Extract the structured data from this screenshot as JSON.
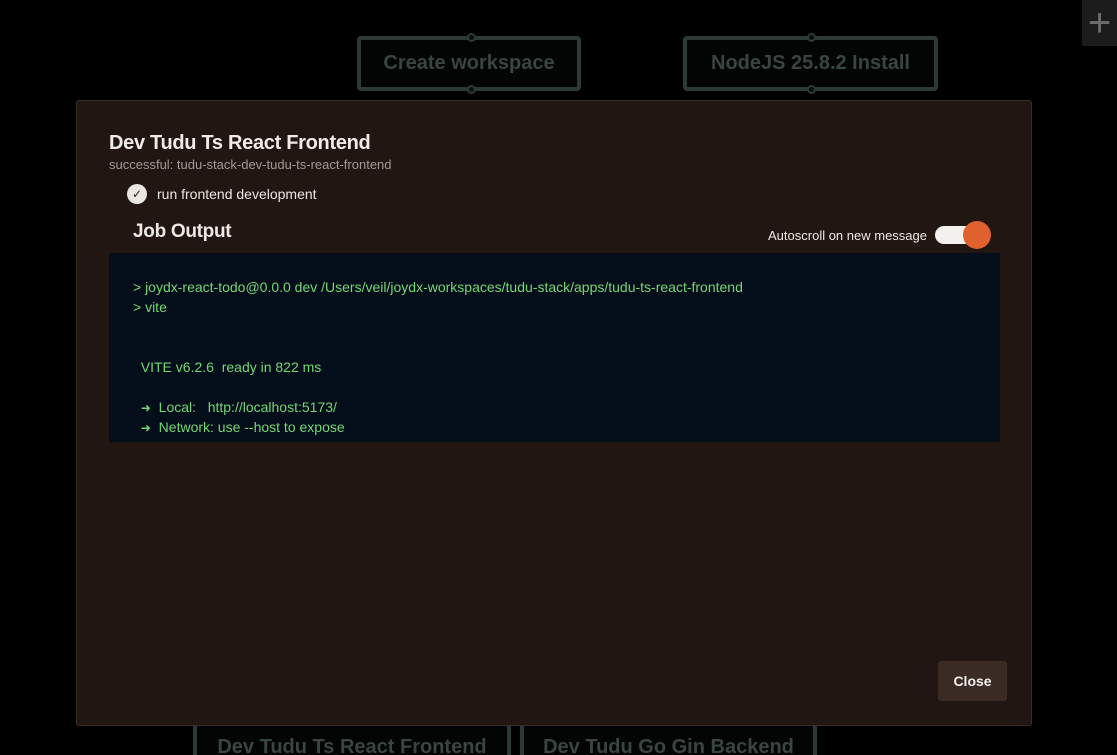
{
  "background": {
    "nodes": {
      "create_workspace": "Create workspace",
      "nodejs_install": "NodeJS 25.8.2 Install",
      "react_frontend": "Dev Tudu Ts React Frontend",
      "go_backend": "Dev Tudu Go Gin Backend"
    },
    "add_button": "+"
  },
  "modal": {
    "title": "Dev Tudu Ts React Frontend",
    "subtitle": "successful: tudu-stack-dev-tudu-ts-react-frontend",
    "step": {
      "icon": "check-icon",
      "label": "run frontend development",
      "status": "successful"
    },
    "job_output": {
      "title": "Job Output",
      "autoscroll_label": "Autoscroll on new message",
      "autoscroll_enabled": true,
      "lines": [
        "> joydx-react-todo@0.0.0 dev /Users/veil/joydx-workspaces/tudu-stack/apps/tudu-ts-react-frontend",
        "> vite",
        "",
        "",
        "  VITE v6.2.6  ready in 822 ms",
        "",
        "Local:   http://localhost:5173/",
        "Network: use --host to expose"
      ]
    },
    "close_label": "Close"
  },
  "colors": {
    "modal_bg": "#211611",
    "output_bg": "#040d1a",
    "output_text": "#74d874",
    "toggle_accent": "#e0602e"
  }
}
